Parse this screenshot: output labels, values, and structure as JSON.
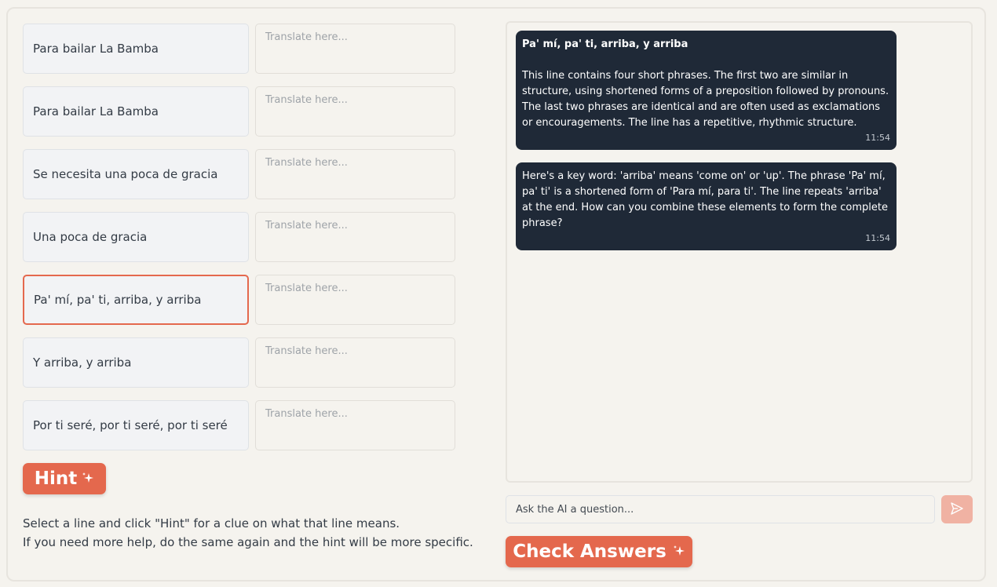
{
  "lines": [
    {
      "text": "Para bailar La Bamba",
      "placeholder": "Translate here..."
    },
    {
      "text": "Para bailar La Bamba",
      "placeholder": "Translate here..."
    },
    {
      "text": "Se necesita una poca de gracia",
      "placeholder": "Translate here..."
    },
    {
      "text": "Una poca de gracia",
      "placeholder": "Translate here..."
    },
    {
      "text": "Pa' mí, pa' ti, arriba, y arriba",
      "placeholder": "Translate here..."
    },
    {
      "text": "Y arriba, y arriba",
      "placeholder": "Translate here..."
    },
    {
      "text": "Por ti seré, por ti seré, por ti seré",
      "placeholder": "Translate here..."
    }
  ],
  "selected_line_index": 4,
  "hint_button": {
    "label": "Hint"
  },
  "instructions": {
    "line1": "Select a line and click \"Hint\" for a clue on what that line means.",
    "line2": "If you need more help, do the same again and the hint will be more specific."
  },
  "chat": {
    "messages": [
      {
        "title": "Pa' mí, pa' ti, arriba, y arriba",
        "body": "This line contains four short phrases. The first two are similar in structure, using shortened forms of a preposition followed by pronouns. The last two phrases are identical and are often used as exclamations or encouragements. The line has a repetitive, rhythmic structure.",
        "time": "11:54"
      },
      {
        "body": "Here's a key word: 'arriba' means 'come on' or 'up'. The phrase 'Pa' mí, pa' ti' is a shortened form of 'Para mí, para ti'. The line repeats 'arriba' at the end. How can you combine these elements to form the complete phrase?",
        "time": "11:54"
      }
    ],
    "input_placeholder": "Ask the AI a question..."
  },
  "check_button": {
    "label": "Check Answers"
  },
  "colors": {
    "accent": "#e4684d",
    "accent_light": "#f0b2a3",
    "bubble_bg": "#1f2937",
    "page_bg": "#f5f3ee"
  },
  "icons": {
    "hint": "sparkle-icon",
    "check": "sparkle-icon",
    "send": "send-icon"
  }
}
